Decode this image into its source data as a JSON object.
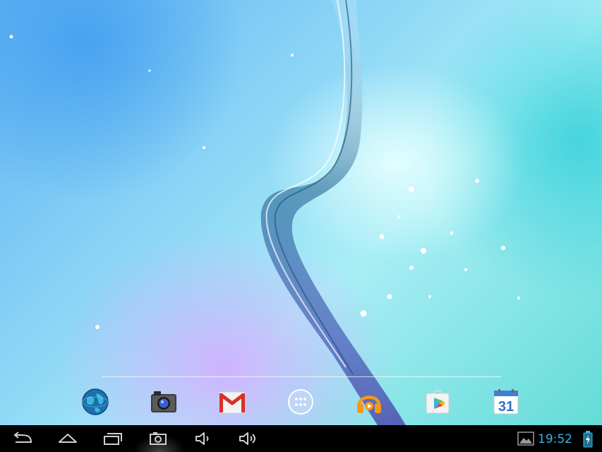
{
  "status": {
    "time": "19:52"
  },
  "dock": {
    "apps": [
      {
        "icon": "browser-globe-icon"
      },
      {
        "icon": "camera-icon"
      },
      {
        "icon": "gmail-icon"
      },
      {
        "icon": "app-drawer-icon"
      },
      {
        "icon": "play-music-icon"
      },
      {
        "icon": "play-store-icon"
      },
      {
        "icon": "calendar-icon",
        "label": "31"
      }
    ]
  },
  "navigation": {
    "buttons": [
      "back-icon",
      "home-icon",
      "recent-apps-icon",
      "screenshot-icon",
      "volume-down-icon",
      "volume-up-icon"
    ]
  },
  "colors": {
    "clock": "#33b5e5",
    "navbar": "#000000",
    "accent_orange": "#f59a16"
  }
}
